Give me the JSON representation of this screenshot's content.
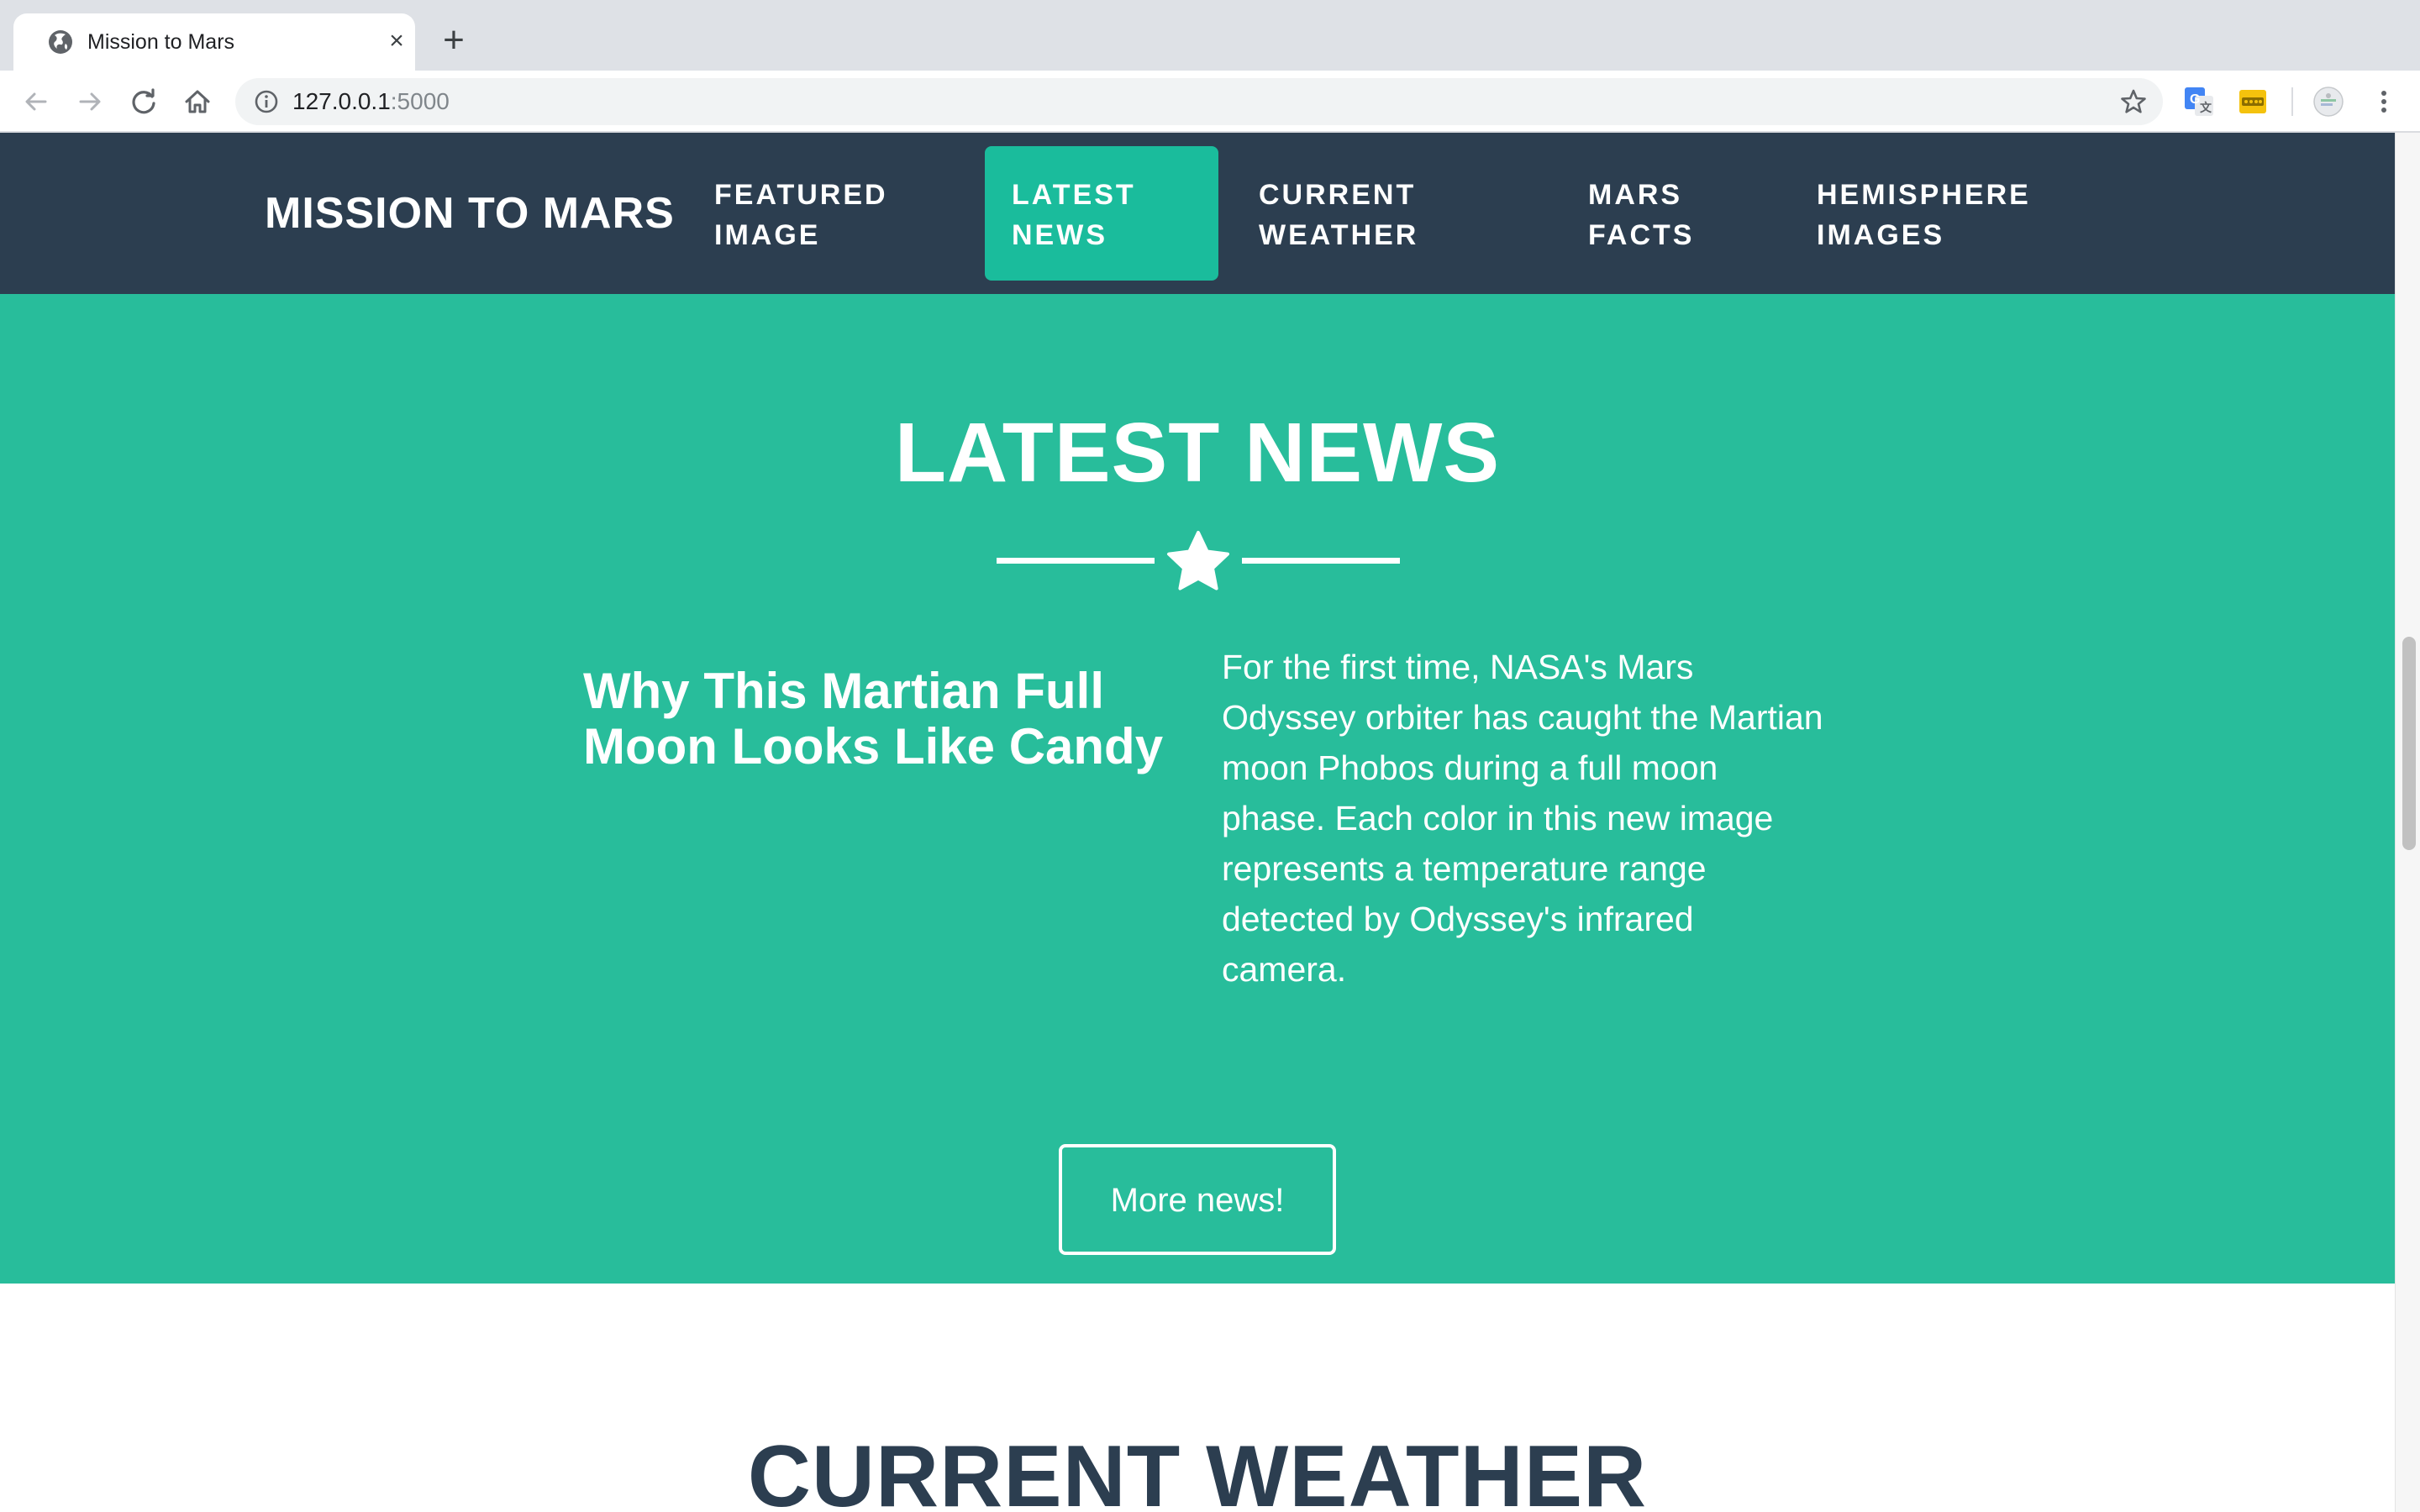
{
  "browser": {
    "tab_title": "Mission to Mars",
    "url_host": "127.0.0.1",
    "url_port": ":5000"
  },
  "site": {
    "brand": "MISSION TO MARS",
    "nav": [
      {
        "line1": "FEATURED",
        "line2": "IMAGE"
      },
      {
        "line1": "LATEST",
        "line2": "NEWS"
      },
      {
        "line1": "CURRENT",
        "line2": "WEATHER"
      },
      {
        "line1": "MARS",
        "line2": "FACTS"
      },
      {
        "line1": "HEMISPHERE",
        "line2": "IMAGES"
      }
    ],
    "active_nav": "LATEST NEWS",
    "colors": {
      "navbar": "#2c3e50",
      "accent": "#1abc9c",
      "section": "#28bd9b"
    }
  },
  "news": {
    "section_title": "LATEST NEWS",
    "article_title_line1": "Why This Martian Full",
    "article_title_line2": "Moon Looks Like Candy",
    "article_body": "For the first time, NASA's Mars Odyssey orbiter has caught the Martian moon Phobos during a full moon phase. Each color in this new image represents a temperature range detected by Odyssey's infrared camera.",
    "more_button": "More news!"
  },
  "weather": {
    "section_title": "CURRENT WEATHER"
  }
}
